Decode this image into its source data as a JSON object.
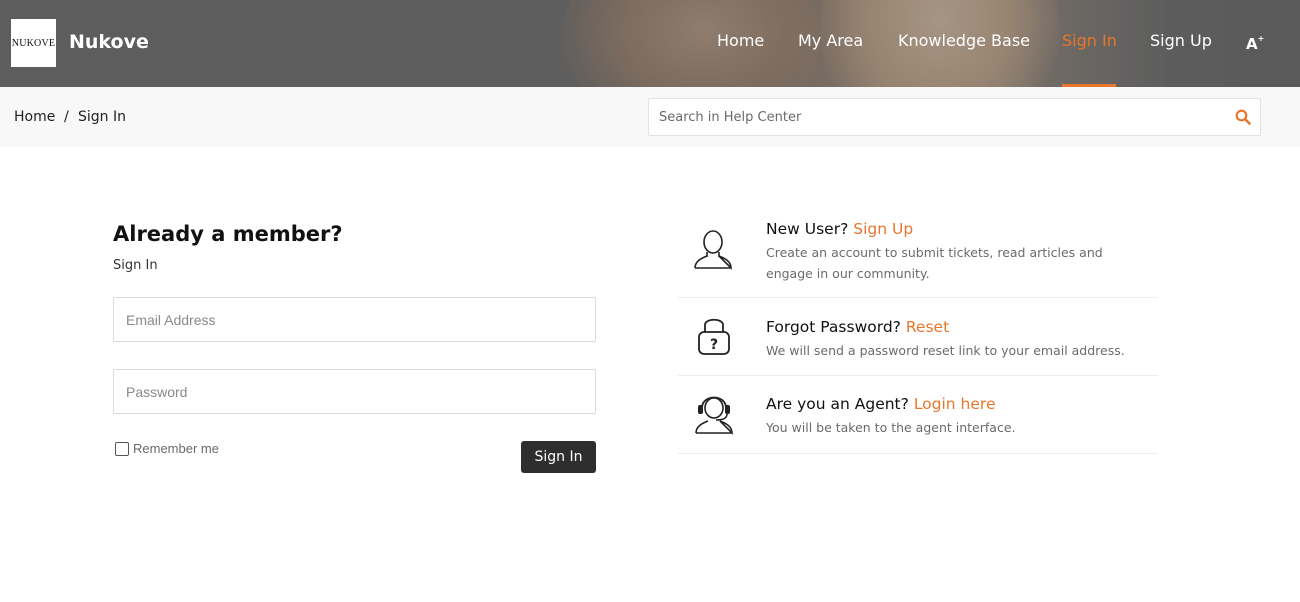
{
  "header": {
    "logo_text": "NUKOVE",
    "brand": "Nukove",
    "nav": [
      {
        "label": "Home"
      },
      {
        "label": "My Area"
      },
      {
        "label": "Knowledge Base"
      },
      {
        "label": "Sign In",
        "active": true
      },
      {
        "label": "Sign Up"
      }
    ],
    "font_icon": "A"
  },
  "breadcrumb": {
    "home": "Home",
    "separator": "/",
    "current": "Sign In"
  },
  "search": {
    "placeholder": "Search in Help Center",
    "icon": "search-icon"
  },
  "form": {
    "title": "Already a member?",
    "subtitle": "Sign In",
    "email_placeholder": "Email Address",
    "password_placeholder": "Password",
    "remember_label": "Remember me",
    "remember_checked": false,
    "submit_label": "Sign In"
  },
  "info": [
    {
      "icon": "user-icon",
      "title": "New User?",
      "link": "Sign Up",
      "description": "Create an account to submit tickets, read articles and engage in our community."
    },
    {
      "icon": "lock-question-icon",
      "title": "Forgot Password?",
      "link": "Reset",
      "description": "We will send a password reset link to your email address."
    },
    {
      "icon": "agent-headset-icon",
      "title": "Are you an Agent?",
      "link": "Login here",
      "description": "You will be taken to the agent interface."
    }
  ],
  "colors": {
    "accent": "#e8762c",
    "button_bg": "#2e2e2e",
    "subbar_bg": "#f8f8f8"
  }
}
